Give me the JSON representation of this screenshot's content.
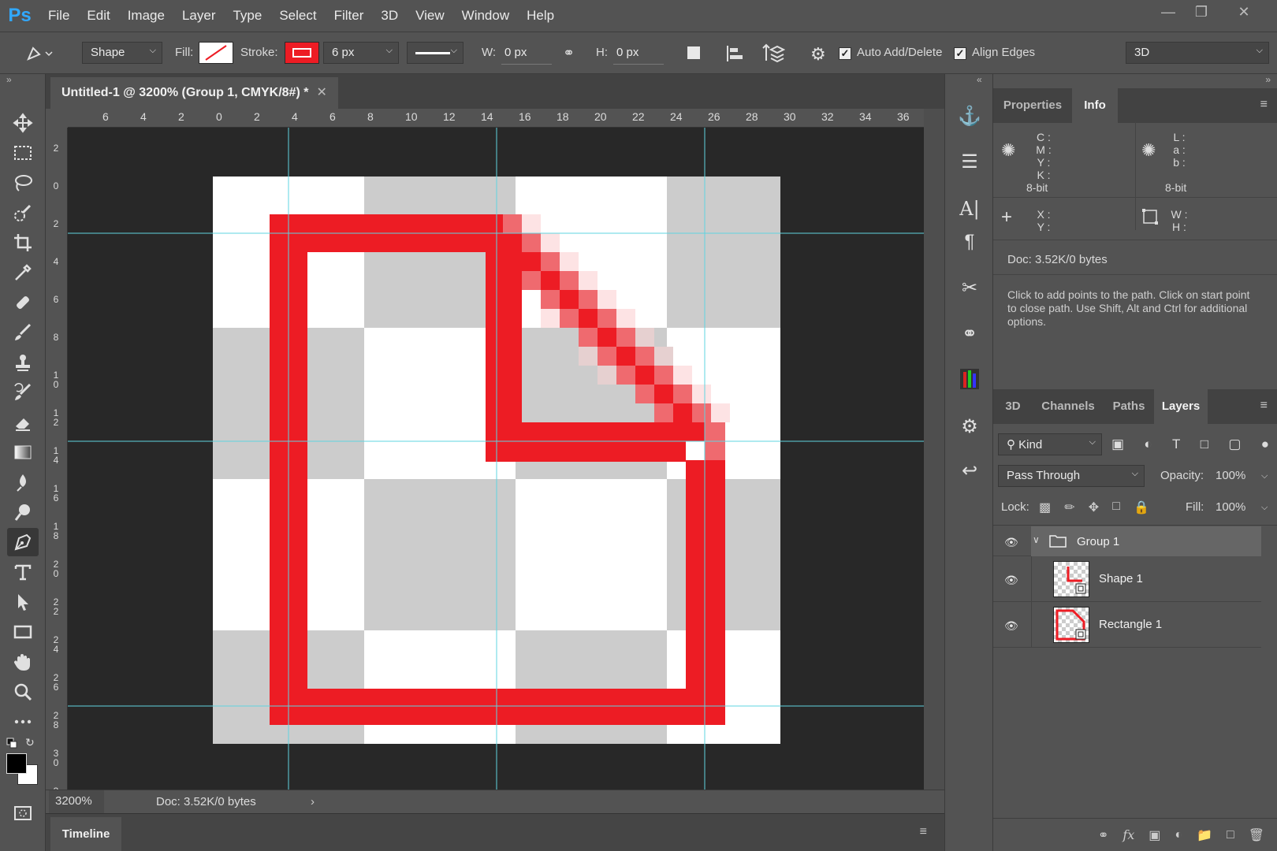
{
  "app": {
    "logo": "Ps"
  },
  "menu": [
    "File",
    "Edit",
    "Image",
    "Layer",
    "Type",
    "Select",
    "Filter",
    "3D",
    "View",
    "Window",
    "Help"
  ],
  "window_controls": {
    "minimize": "minimize-icon",
    "restore": "restore-icon",
    "close": "close-icon"
  },
  "options": {
    "tool_mode": "Shape",
    "fill_label": "Fill:",
    "stroke_label": "Stroke:",
    "stroke_color": "#ed1c24",
    "stroke_width": "6 px",
    "w_label": "W:",
    "w_value": "0 px",
    "h_label": "H:",
    "h_value": "0 px",
    "auto_add_delete": "Auto Add/Delete",
    "align_edges": "Align Edges",
    "workspace": "3D"
  },
  "document": {
    "tab_title": "Untitled-1 @ 3200% (Group 1, CMYK/8#) *",
    "ruler_h": [
      "6",
      "4",
      "2",
      "0",
      "2",
      "4",
      "6",
      "8",
      "10",
      "12",
      "14",
      "16",
      "18",
      "20",
      "22",
      "24",
      "26",
      "28",
      "30",
      "32",
      "34",
      "36"
    ],
    "ruler_v": [
      "2",
      "0",
      "2",
      "4",
      "6",
      "8",
      "10",
      "12",
      "14",
      "16",
      "18",
      "20",
      "22",
      "24",
      "26",
      "28",
      "30",
      "3"
    ],
    "shape_color": "#ed1c24"
  },
  "status": {
    "zoom": "3200%",
    "doc": "Doc: 3.52K/0 bytes"
  },
  "timeline": {
    "label": "Timeline"
  },
  "panels": {
    "top_tabs": [
      "Properties",
      "Info"
    ],
    "info": {
      "cmyk_labels": [
        "C :",
        "M :",
        "Y :",
        "K :"
      ],
      "cmyk_bit": "8-bit",
      "lab_labels": [
        "L :",
        "a :",
        "b :"
      ],
      "lab_bit": "8-bit",
      "xy_labels": [
        "X :",
        "Y :"
      ],
      "wh_labels": [
        "W :",
        "H :"
      ],
      "doc": "Doc: 3.52K/0 bytes",
      "hint": "Click to add points to the path.  Click on start point to close path.  Use Shift, Alt and Ctrl for additional options."
    },
    "bottom_tabs": [
      "3D",
      "Channels",
      "Paths",
      "Layers"
    ],
    "layers": {
      "filter_kind": "Kind",
      "blend_mode": "Pass Through",
      "opacity_label": "Opacity:",
      "opacity": "100%",
      "lock_label": "Lock:",
      "fill_label": "Fill:",
      "fill": "100%",
      "items": [
        {
          "name": "Group 1",
          "type": "group"
        },
        {
          "name": "Shape 1",
          "type": "shape"
        },
        {
          "name": "Rectangle 1",
          "type": "shape"
        }
      ]
    }
  }
}
